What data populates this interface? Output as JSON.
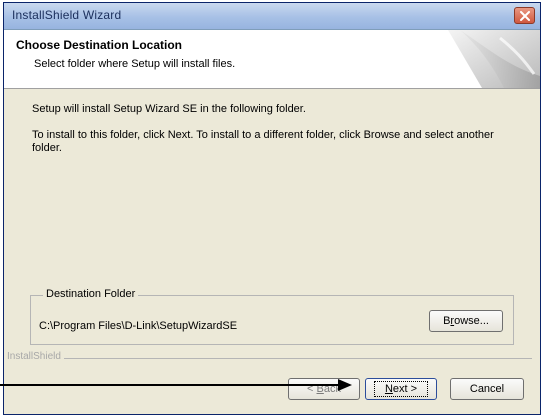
{
  "window": {
    "title": "InstallShield Wizard"
  },
  "header": {
    "title": "Choose Destination Location",
    "subtitle": "Select folder where Setup will install files."
  },
  "content": {
    "intro": "Setup will install Setup Wizard SE in the following folder.",
    "instructions": "To install to this folder, click Next. To install to a different folder, click Browse and select another folder."
  },
  "destination": {
    "legend": "Destination Folder",
    "path": "C:\\Program Files\\D-Link\\SetupWizardSE",
    "browse_pre": "B",
    "browse_ul": "r",
    "browse_post": "owse..."
  },
  "footer": {
    "brand": "InstallShield",
    "back_pre": "< ",
    "back_ul": "B",
    "back_post": "ack",
    "next_ul": "N",
    "next_post": "ext >",
    "cancel": "Cancel"
  },
  "colors": {
    "dialog_background": "#ece9d8",
    "title_bar": "#a7c0e6",
    "close_button": "#d0583f"
  }
}
